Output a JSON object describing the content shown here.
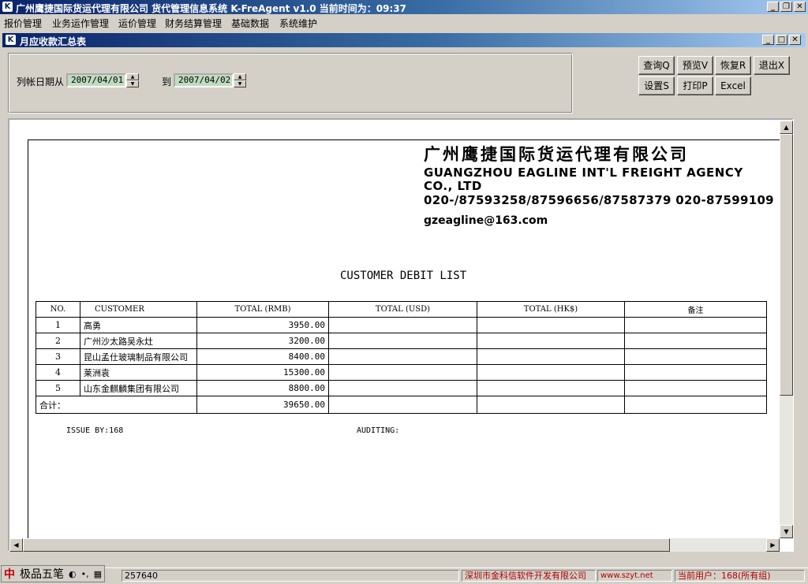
{
  "app": {
    "title": "广州鹰捷国际货运代理有限公司  货代管理信息系统 K-FreAgent v1.0  当前时间为：09:37",
    "window_buttons": [
      "_",
      "❐",
      "✕"
    ]
  },
  "menu": [
    "报价管理",
    "业务运作管理",
    "运价管理",
    "财务结算管理",
    "基础数据",
    "系统维护"
  ],
  "child_window": {
    "title": "月应收款汇总表",
    "buttons": [
      "_",
      "□",
      "✕"
    ]
  },
  "filter": {
    "date_from_label": "列帐日期从",
    "date_from": "2007/04/01",
    "date_to_label": "到",
    "date_to": "2007/04/02"
  },
  "toolbar": {
    "query": "查询Q",
    "preview": "预览V",
    "restore": "恢复R",
    "exit": "退出X",
    "settings": "设置S",
    "print": "打印P",
    "excel": "Excel"
  },
  "report": {
    "company_cn": "广州鹰捷国际货运代理有限公司",
    "company_en": "GUANGZHOU EAGLINE INT'L FREIGHT AGENCY CO., LTD",
    "phone": "020-/87593258/87596656/87587379  020-87599109",
    "email": "gzeagline@163.com",
    "title": "CUSTOMER DEBIT LIST",
    "columns": [
      "NO.",
      "CUSTOMER",
      "TOTAL (RMB)",
      "TOTAL (USD)",
      "TOTAL (HK$)",
      "备注"
    ],
    "rows": [
      {
        "no": "1",
        "customer": "高勇",
        "rmb": "3950.00",
        "usd": "",
        "hkd": "",
        "note": ""
      },
      {
        "no": "2",
        "customer": "广州沙太路吴永灶",
        "rmb": "3200.00",
        "usd": "",
        "hkd": "",
        "note": ""
      },
      {
        "no": "3",
        "customer": "昆山孟仕玻璃制品有限公司",
        "rmb": "8400.00",
        "usd": "",
        "hkd": "",
        "note": ""
      },
      {
        "no": "4",
        "customer": "莱洲袁",
        "rmb": "15300.00",
        "usd": "",
        "hkd": "",
        "note": ""
      },
      {
        "no": "5",
        "customer": "山东金麒麟集团有限公司",
        "rmb": "8800.00",
        "usd": "",
        "hkd": "",
        "note": ""
      }
    ],
    "total_label": "合计：",
    "total_rmb": "39650.00",
    "issue_by": "ISSUE BY:168",
    "auditing": "AUDITING:"
  },
  "statusbar": {
    "ime_icon": "中",
    "ime_label": "极品五笔",
    "partial_number": "257640",
    "vendor": "深圳市金科信软件开发有限公司",
    "url": "www.szyt.net",
    "current_user": "当前用户：168(所有组)"
  }
}
